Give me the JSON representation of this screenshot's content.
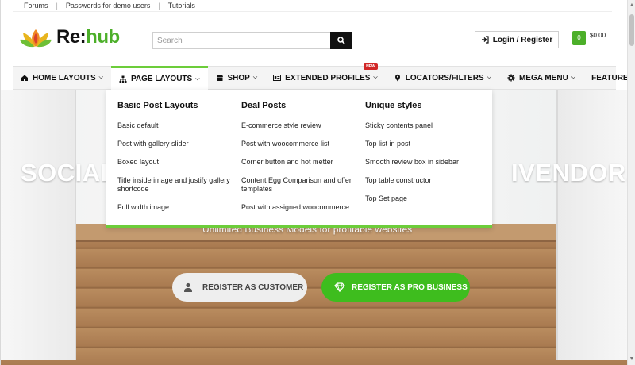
{
  "topbar": {
    "links": [
      "Forums",
      "Passwords for demo users",
      "Tutorials"
    ]
  },
  "header": {
    "logo_text_main": "Re:",
    "logo_text_accent": "hub",
    "search_placeholder": "Search",
    "login_label": "Login / Register",
    "cart_count": "0",
    "cart_total": "$0.00"
  },
  "nav": {
    "items": [
      {
        "label": "HOME LAYOUTS",
        "icon": "home-icon"
      },
      {
        "label": "PAGE LAYOUTS",
        "icon": "sitemap-icon"
      },
      {
        "label": "SHOP",
        "icon": "shop-icon"
      },
      {
        "label": "EXTENDED PROFILES",
        "icon": "id-card-icon",
        "badge": "NEW"
      },
      {
        "label": "LOCATORS/FILTERS",
        "icon": "map-marker-icon"
      },
      {
        "label": "MEGA MENU",
        "icon": "gear-icon"
      },
      {
        "label": "FEATURES"
      }
    ]
  },
  "mega_menu": {
    "columns": [
      {
        "heading": "Basic Post Layouts",
        "links": [
          "Basic default",
          "Post with gallery slider",
          "Boxed layout",
          "Title inside image and justify gallery shortcode",
          "Full width image"
        ]
      },
      {
        "heading": "Deal Posts",
        "links": [
          "E-commerce style review",
          "Post with woocommerce list",
          "Corner button and hot metter",
          "Content Egg Comparison and offer templates",
          "Post with assigned woocommerce"
        ]
      },
      {
        "heading": "Unique styles",
        "links": [
          "Sticky contents panel",
          "Top list in post",
          "Smooth review box in sidebar",
          "Top table constructor",
          "Top Set page"
        ]
      }
    ]
  },
  "hero": {
    "title_left": "SOCIAL",
    "title_right": "IVENDOR,",
    "subtitle": "Unlimited Business Models for profitable websites",
    "cta_customer": "REGISTER AS CUSTOMER",
    "cta_pro": "REGISTER AS PRO BUSINESS"
  },
  "colors": {
    "brand_green": "#4caf29",
    "cta_green": "#3ebd1e",
    "nav_active_border": "#6ccd3a",
    "badge_red": "#d12727"
  }
}
